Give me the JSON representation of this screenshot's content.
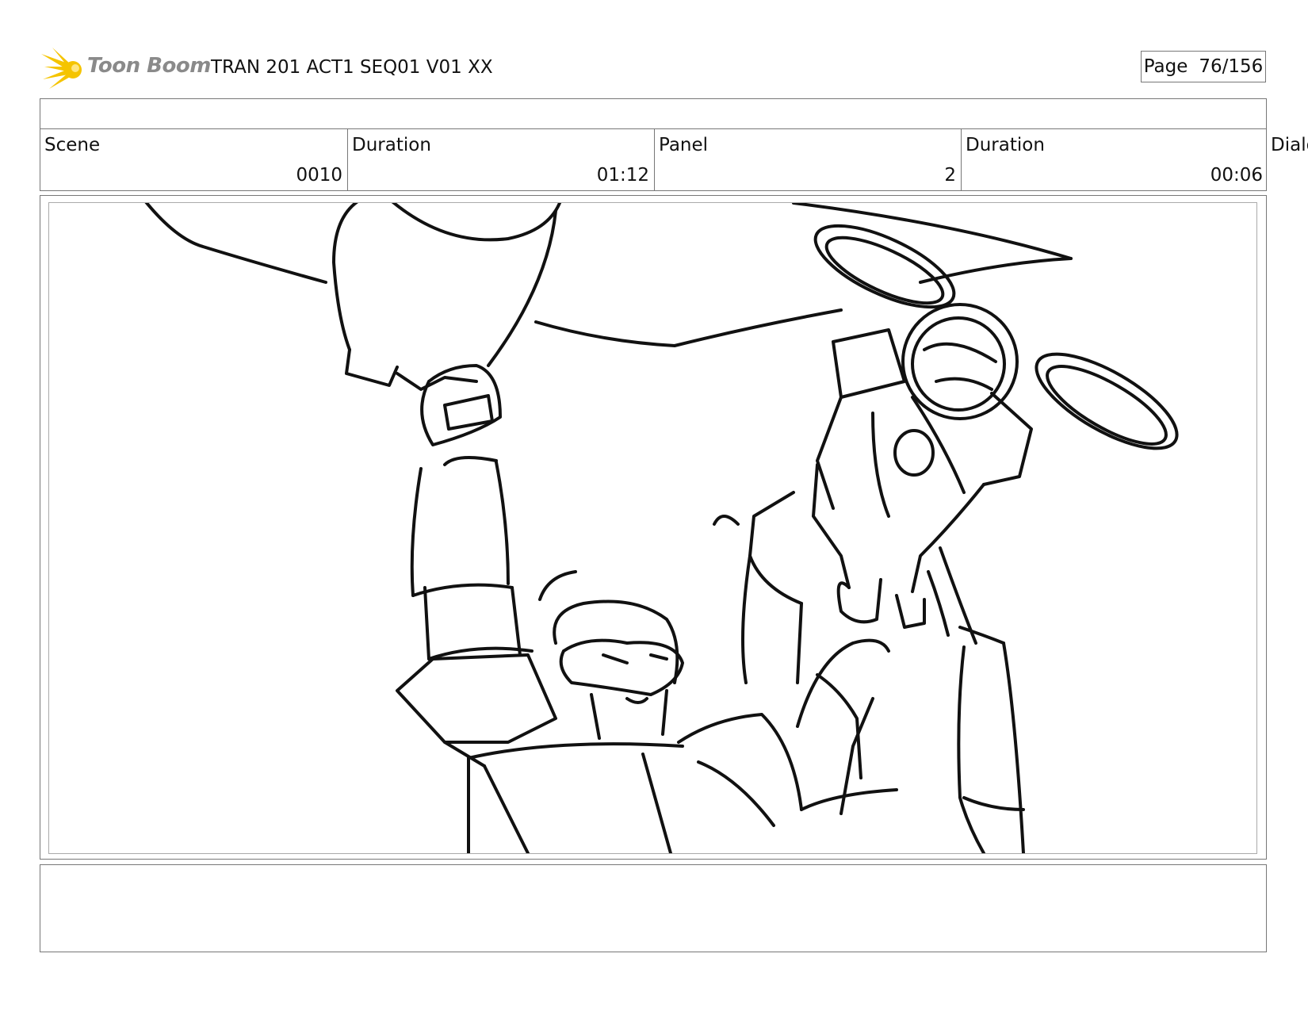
{
  "header": {
    "logo_text": "Toon Boom",
    "doc_title": "TRAN 201 ACT1 SEQ01 V01 XX",
    "page_label": "Page",
    "page_number": "76/156"
  },
  "info": {
    "scene_label": "Scene",
    "scene_value": "0010",
    "scene_duration_label": "Duration",
    "scene_duration_value": "01:12",
    "panel_label": "Panel",
    "panel_value": "2",
    "panel_duration_label": "Duration",
    "panel_duration_value": "00:06",
    "dialog_label": "Dialo"
  },
  "colors": {
    "logo_burst": "#f5c400",
    "logo_text": "#8a8a8a",
    "border": "#777777",
    "sketch_ink": "#111111"
  },
  "icons": {
    "logo": "toon-boom-burst-icon"
  }
}
